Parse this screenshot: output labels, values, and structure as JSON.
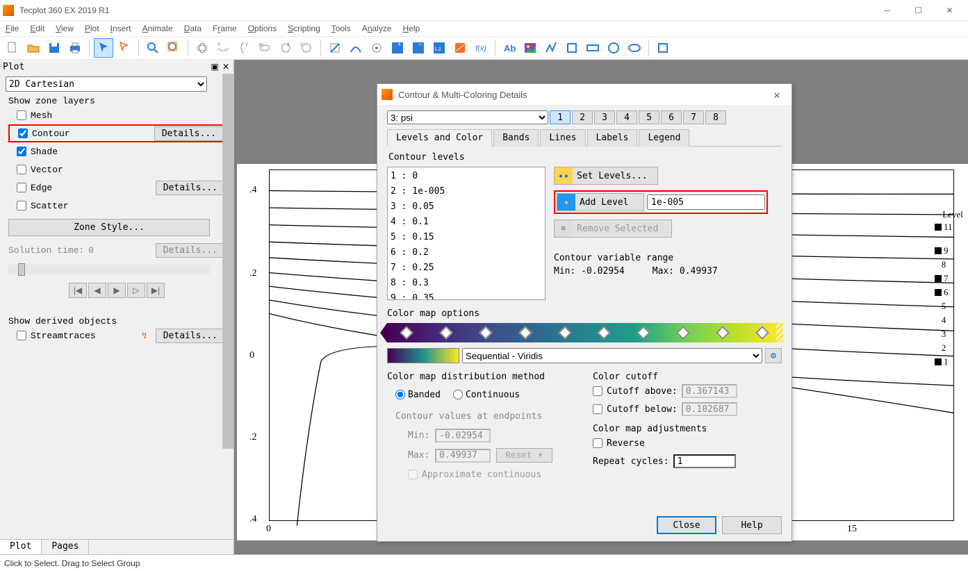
{
  "window": {
    "title": "Tecplot 360 EX 2019 R1"
  },
  "menu": [
    "File",
    "Edit",
    "View",
    "Plot",
    "Insert",
    "Animate",
    "Data",
    "Frame",
    "Options",
    "Scripting",
    "Tools",
    "Analyze",
    "Help"
  ],
  "sidebar": {
    "header": "Plot",
    "plot_type": "2D Cartesian",
    "show_zone_label": "Show zone layers",
    "layers": [
      {
        "label": "Mesh",
        "checked": false,
        "details": false
      },
      {
        "label": "Contour",
        "checked": true,
        "details": true
      },
      {
        "label": "Shade",
        "checked": true,
        "details": false
      },
      {
        "label": "Vector",
        "checked": false,
        "details": false
      },
      {
        "label": "Edge",
        "checked": false,
        "details": true
      },
      {
        "label": "Scatter",
        "checked": false,
        "details": false
      }
    ],
    "details_btn": "Details...",
    "zone_style": "Zone Style...",
    "solution_time_label": "Solution time:",
    "solution_time_value": "0",
    "show_derived_label": "Show derived objects",
    "streamtraces_label": "Streamtraces",
    "tabs": [
      "Plot",
      "Pages"
    ]
  },
  "plot_axes": {
    "yticks": [
      ".4",
      ".2",
      "0",
      ".2",
      ".4"
    ],
    "xticks": [
      "0",
      "15"
    ]
  },
  "legend": {
    "header": "Level",
    "items": [
      "11",
      "9",
      "8",
      "7",
      "6",
      "5",
      "4",
      "3",
      "2",
      "1"
    ]
  },
  "dialog": {
    "title": "Contour & Multi-Coloring Details",
    "var": "3: psi",
    "groups": [
      "1",
      "2",
      "3",
      "4",
      "5",
      "6",
      "7",
      "8"
    ],
    "active_group": "1",
    "tabs": [
      "Levels and Color",
      "Bands",
      "Lines",
      "Labels",
      "Legend"
    ],
    "active_tab": "Levels and Color",
    "contour_levels_label": "Contour levels",
    "levels": [
      "1 : 0",
      "2 : 1e-005",
      "3 : 0.05",
      "4 : 0.1",
      "5 : 0.15",
      "6 : 0.2",
      "7 : 0.25",
      "8 : 0.3",
      "9 : 0.35"
    ],
    "set_levels": "Set Levels...",
    "add_level": "Add Level",
    "add_value": "1e-005",
    "remove_selected": "Remove Selected",
    "cvr_label": "Contour variable range",
    "cvr_min_label": "Min:",
    "cvr_min": "-0.02954",
    "cvr_max_label": "Max:",
    "cvr_max": "0.49937",
    "cmap_label": "Color map options",
    "cmap_name": "Sequential - Viridis",
    "dist_label": "Color map distribution method",
    "banded": "Banded",
    "continuous": "Continuous",
    "endpoints_label": "Contour values at endpoints",
    "end_min_label": "Min:",
    "end_min": "-0.02954",
    "end_max_label": "Max:",
    "end_max": "0.49937",
    "reset_btn": "Reset",
    "approx_label": "Approximate continuous",
    "cutoff_label": "Color cutoff",
    "cutoff_above_label": "Cutoff above:",
    "cutoff_above": "0.367143",
    "cutoff_below_label": "Cutoff below:",
    "cutoff_below": "0.102687",
    "adjust_label": "Color map adjustments",
    "reverse_label": "Reverse",
    "repeat_label": "Repeat cycles:",
    "repeat_value": "1",
    "close": "Close",
    "help": "Help"
  },
  "status": "Click to Select. Drag to Select Group"
}
